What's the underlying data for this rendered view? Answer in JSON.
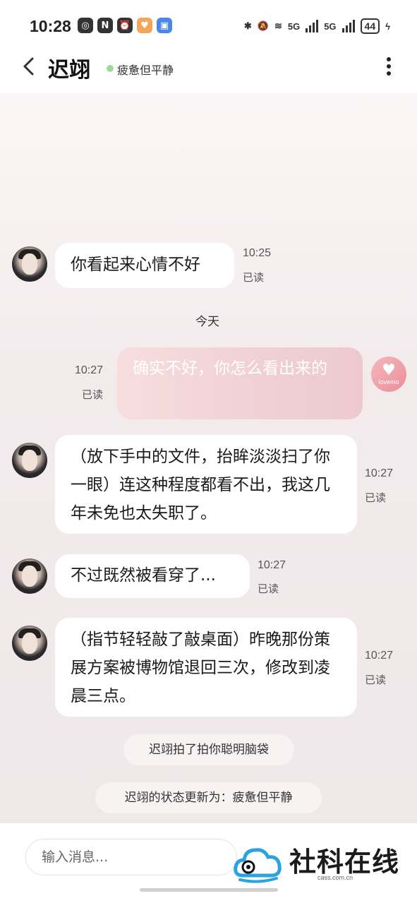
{
  "status_bar": {
    "time": "10:28",
    "left_icons": [
      "nfc-tag-icon",
      "n-icon",
      "alarm-icon",
      "heart-app-icon",
      "app-store-icon"
    ],
    "right": {
      "network1": "5G",
      "network2": "5G",
      "battery": "44"
    }
  },
  "header": {
    "contact_name": "迟翊",
    "contact_status": "疲惫但平静"
  },
  "messages": [
    {
      "from": "bot",
      "text": "你看起来心情不好",
      "time": "10:25",
      "read": "已读"
    },
    {
      "type": "date",
      "text": "今天"
    },
    {
      "from": "me",
      "text": "确实不好，你怎么看出来的",
      "time": "10:27",
      "read": "已读",
      "avatar_text": "lovemo"
    },
    {
      "from": "bot",
      "text": "（放下手中的文件，抬眸淡淡扫了你一眼）连这种程度都看不出，我这几年未免也太失职了。",
      "time": "10:27",
      "read": "已读"
    },
    {
      "from": "bot",
      "text": "不过既然被看穿了...",
      "time": "10:27",
      "read": "已读"
    },
    {
      "from": "bot",
      "text": "（指节轻轻敲了敲桌面）昨晚那份策展方案被博物馆退回三次，修改到凌晨三点。",
      "time": "10:27",
      "read": "已读"
    },
    {
      "type": "system",
      "text": "迟翊拍了拍你聪明脑袋"
    },
    {
      "type": "system",
      "text": "迟翊的状态更新为：疲惫但平静"
    }
  ],
  "input": {
    "placeholder": "输入消息..."
  },
  "watermark": {
    "title": "社科在线",
    "subtitle": "cass.com.cn"
  },
  "colors": {
    "accent_pink": "#edc9cd",
    "status_dot": "#9ed99e",
    "chat_bg": "#f3eaec"
  }
}
